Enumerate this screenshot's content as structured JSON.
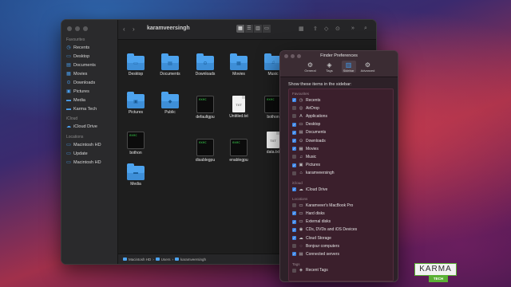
{
  "finder": {
    "title": "karamveersingh",
    "sidebar": {
      "favourites_heading": "Favourites",
      "favourites": [
        {
          "label": "Recents",
          "icon": "clock-icon"
        },
        {
          "label": "Desktop",
          "icon": "desktop-icon"
        },
        {
          "label": "Documents",
          "icon": "document-icon"
        },
        {
          "label": "Movies",
          "icon": "film-icon"
        },
        {
          "label": "Downloads",
          "icon": "download-icon"
        },
        {
          "label": "Pictures",
          "icon": "pictures-icon"
        },
        {
          "label": "Media",
          "icon": "folder-icon"
        },
        {
          "label": "Karma Tech",
          "icon": "folder-icon"
        }
      ],
      "icloud_heading": "iCloud",
      "icloud": [
        {
          "label": "iCloud Drive",
          "icon": "cloud-icon"
        }
      ],
      "locations_heading": "Locations",
      "locations": [
        {
          "label": "Macintosh HD",
          "icon": "drive-icon"
        },
        {
          "label": "Update",
          "icon": "drive-icon"
        },
        {
          "label": "Macintosh HD",
          "icon": "drive-icon"
        }
      ]
    },
    "files": [
      {
        "label": "Desktop",
        "kind": "folder",
        "icon": "desktop-icon"
      },
      {
        "label": "Documents",
        "kind": "folder",
        "icon": "document-icon"
      },
      {
        "label": "Downloads",
        "kind": "folder",
        "icon": "download-icon"
      },
      {
        "label": "Movies",
        "kind": "folder",
        "icon": "film-icon"
      },
      {
        "label": "Music",
        "kind": "folder",
        "icon": "music-icon"
      },
      {
        "label": "Pictures",
        "kind": "folder",
        "icon": "pictures-icon"
      },
      {
        "label": "Public",
        "kind": "folder",
        "icon": "public-icon"
      },
      {
        "label": "defaultgpu",
        "kind": "exec"
      },
      {
        "label": "Untitled.txt",
        "kind": "doc",
        "badge": "TXT"
      },
      {
        "label": "bothon",
        "kind": "exec"
      },
      {
        "label": "bothon",
        "kind": "exec"
      },
      {
        "label": "disablegpu",
        "kind": "exec"
      },
      {
        "label": "enablegpu",
        "kind": "exec"
      },
      {
        "label": "data.txt",
        "kind": "doc",
        "badge": "TXT"
      },
      {
        "label": "Media",
        "kind": "folder",
        "icon": "folder-icon"
      }
    ],
    "exec_glyph": "exec",
    "pathbar": [
      "Macintosh HD",
      "Users",
      "karamveersingh"
    ]
  },
  "prefs": {
    "title": "Finder Preferences",
    "tabs": [
      {
        "label": "General",
        "icon": "gear-icon",
        "active": false
      },
      {
        "label": "Tags",
        "icon": "tag-icon",
        "active": false
      },
      {
        "label": "Sidebar",
        "icon": "sidebar-icon",
        "active": true
      },
      {
        "label": "Advanced",
        "icon": "gear-advanced-icon",
        "active": false
      }
    ],
    "show_label": "Show these items in the sidebar:",
    "sections": [
      {
        "heading": "Favourites",
        "items": [
          {
            "label": "Recents",
            "checked": true,
            "icon": "clock-icon"
          },
          {
            "label": "AirDrop",
            "checked": false,
            "icon": "airdrop-icon"
          },
          {
            "label": "Applications",
            "checked": false,
            "icon": "applications-icon"
          },
          {
            "label": "Desktop",
            "checked": true,
            "icon": "desktop-icon"
          },
          {
            "label": "Documents",
            "checked": true,
            "icon": "document-icon"
          },
          {
            "label": "Downloads",
            "checked": true,
            "icon": "download-icon"
          },
          {
            "label": "Movies",
            "checked": true,
            "icon": "film-icon"
          },
          {
            "label": "Music",
            "checked": false,
            "icon": "music-icon"
          },
          {
            "label": "Pictures",
            "checked": true,
            "icon": "pictures-icon"
          },
          {
            "label": "karamveersingh",
            "checked": false,
            "icon": "home-icon"
          }
        ]
      },
      {
        "heading": "iCloud",
        "items": [
          {
            "label": "iCloud Drive",
            "checked": true,
            "icon": "cloud-icon"
          }
        ]
      },
      {
        "heading": "Locations",
        "items": [
          {
            "label": "Karamveer's MacBook Pro",
            "checked": false,
            "icon": "laptop-icon"
          },
          {
            "label": "Hard disks",
            "checked": true,
            "icon": "drive-icon"
          },
          {
            "label": "External disks",
            "checked": true,
            "icon": "drive-icon"
          },
          {
            "label": "CDs, DVDs and iOS Devices",
            "checked": true,
            "icon": "disc-icon"
          },
          {
            "label": "Cloud Storage",
            "checked": true,
            "icon": "cloud-icon"
          },
          {
            "label": "Bonjour computers",
            "checked": false,
            "icon": "bonjour-icon"
          },
          {
            "label": "Connected servers",
            "checked": true,
            "icon": "server-icon"
          }
        ]
      },
      {
        "heading": "Tags",
        "items": [
          {
            "label": "Recent Tags",
            "checked": false,
            "icon": "tag-icon"
          }
        ]
      }
    ]
  },
  "logo": {
    "main": "KARMA",
    "sub": "TECH"
  },
  "colors": {
    "accent": "#3d86e6",
    "folder": "#4da3ee",
    "logo_green": "#5ab034"
  }
}
